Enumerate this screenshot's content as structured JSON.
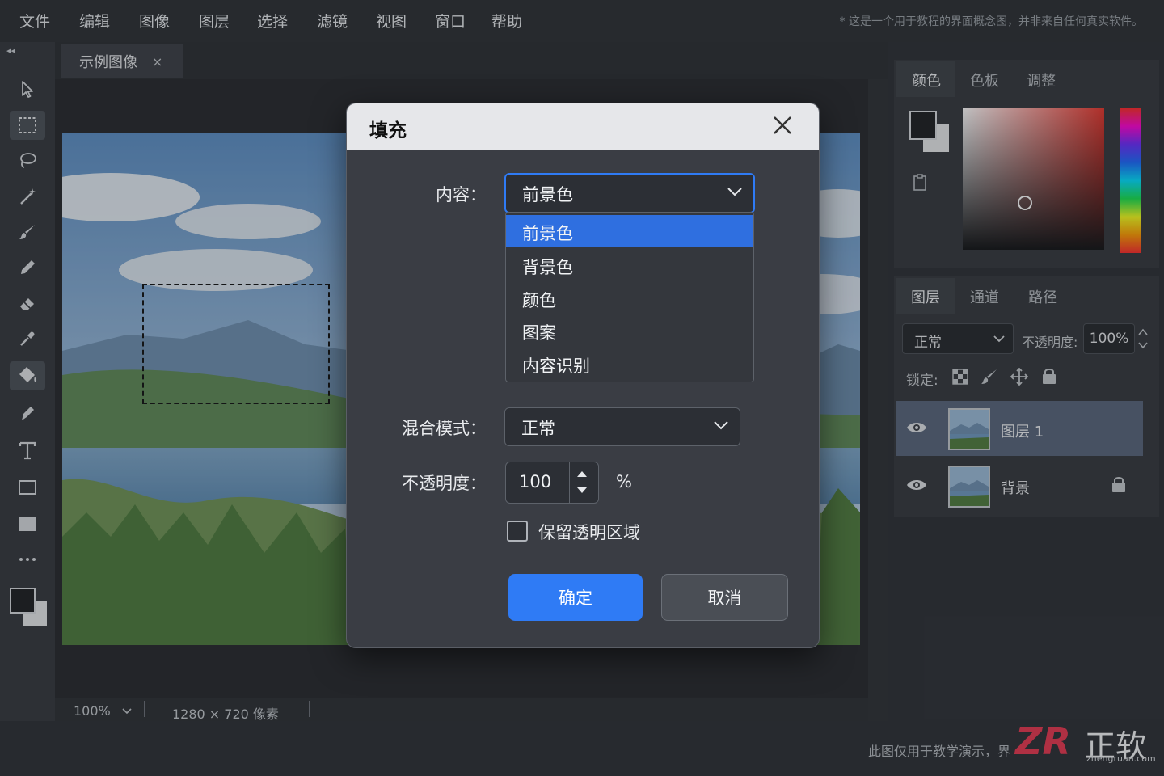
{
  "menubar": {
    "items": [
      "文件",
      "编辑",
      "图像",
      "图层",
      "选择",
      "滤镜",
      "视图",
      "窗口",
      "帮助"
    ],
    "note": "* 这是一个用于教程的界面概念图，并非来自任何真实软件。"
  },
  "collapse_glyph": "◂◂",
  "document_tab": {
    "title": "示例图像",
    "close": "×"
  },
  "status": {
    "zoom": "100%",
    "dimensions": "1280 × 720 像素"
  },
  "right_panel": {
    "color_tabs": [
      "颜色",
      "色板",
      "调整"
    ],
    "layer_tabs": [
      "图层",
      "通道",
      "路径"
    ],
    "blend_mode": "正常",
    "opacity_label": "不透明度:",
    "opacity_value": "100%",
    "lock_label": "锁定:",
    "layers": [
      {
        "name": "图层 1",
        "selected": true
      },
      {
        "name": "背景",
        "locked": true
      }
    ]
  },
  "dialog": {
    "title": "填充",
    "content_label": "内容：",
    "content_value": "前景色",
    "content_options": [
      "前景色",
      "背景色",
      "颜色",
      "图案",
      "内容识别"
    ],
    "highlighted_option": "前景色",
    "blend_label": "混合模式：",
    "blend_value": "正常",
    "opacity_label": "不透明度：",
    "opacity_value": "100",
    "opacity_unit": "%",
    "preserve_transparency_label": "保留透明区域",
    "preserve_transparency_checked": false,
    "ok_label": "确定",
    "cancel_label": "取消"
  },
  "footer_note": "此图仅用于教学演示，界",
  "logo": {
    "mark": "ZR",
    "brand": "正软",
    "site": "zhengruan.com"
  },
  "colors": {
    "accent": "#2f7bf5",
    "highlight": "#2f6fe0",
    "selected_layer": "#58657a"
  }
}
